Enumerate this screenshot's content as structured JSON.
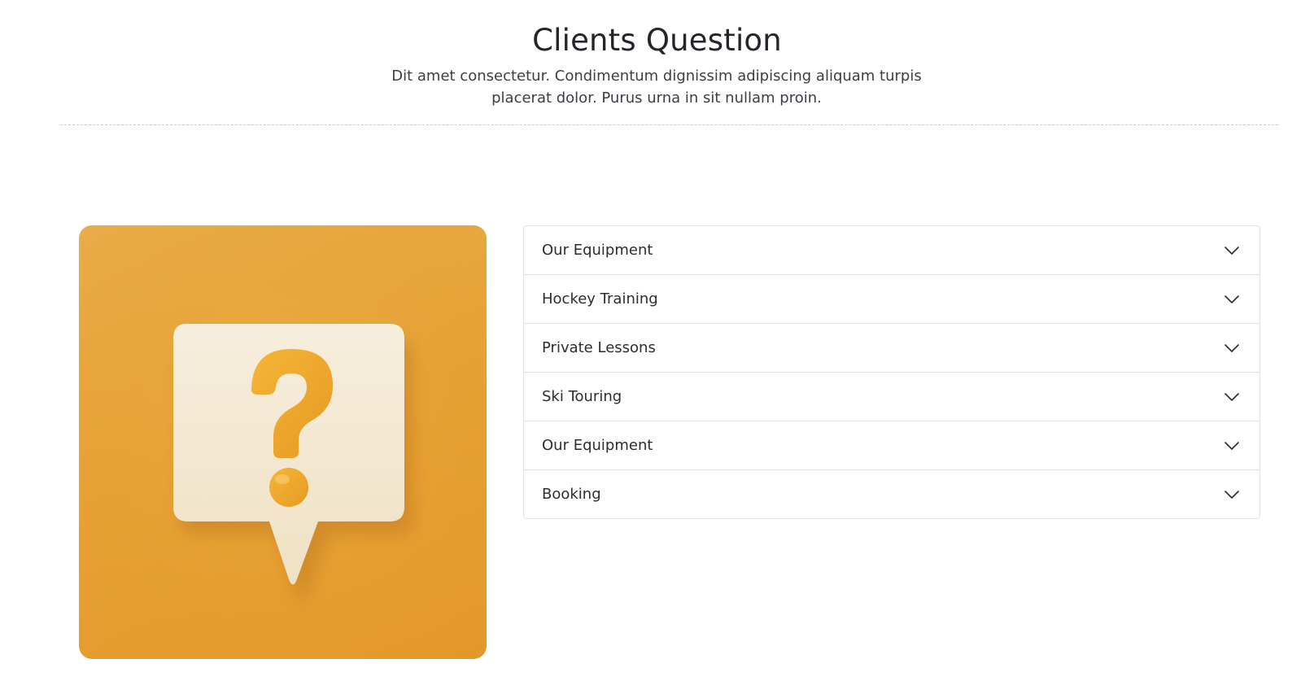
{
  "header": {
    "title": "Clients Question",
    "subtitle": "Dit amet consectetur. Condimentum dignissim adipiscing aliquam turpis placerat dolor. Purus urna in sit nullam proin."
  },
  "image": {
    "icon": "question-mark-speech-bubble",
    "background_color": "#e6a236",
    "bubble_color": "#f2e6cf",
    "mark_color": "#eea92b"
  },
  "faq": {
    "items": [
      {
        "label": "Our Equipment",
        "expanded": false
      },
      {
        "label": "Hockey Training",
        "expanded": false
      },
      {
        "label": "Private Lessons",
        "expanded": false
      },
      {
        "label": "Ski Touring",
        "expanded": false
      },
      {
        "label": "Our Equipment",
        "expanded": false
      },
      {
        "label": "Booking",
        "expanded": false
      }
    ]
  }
}
